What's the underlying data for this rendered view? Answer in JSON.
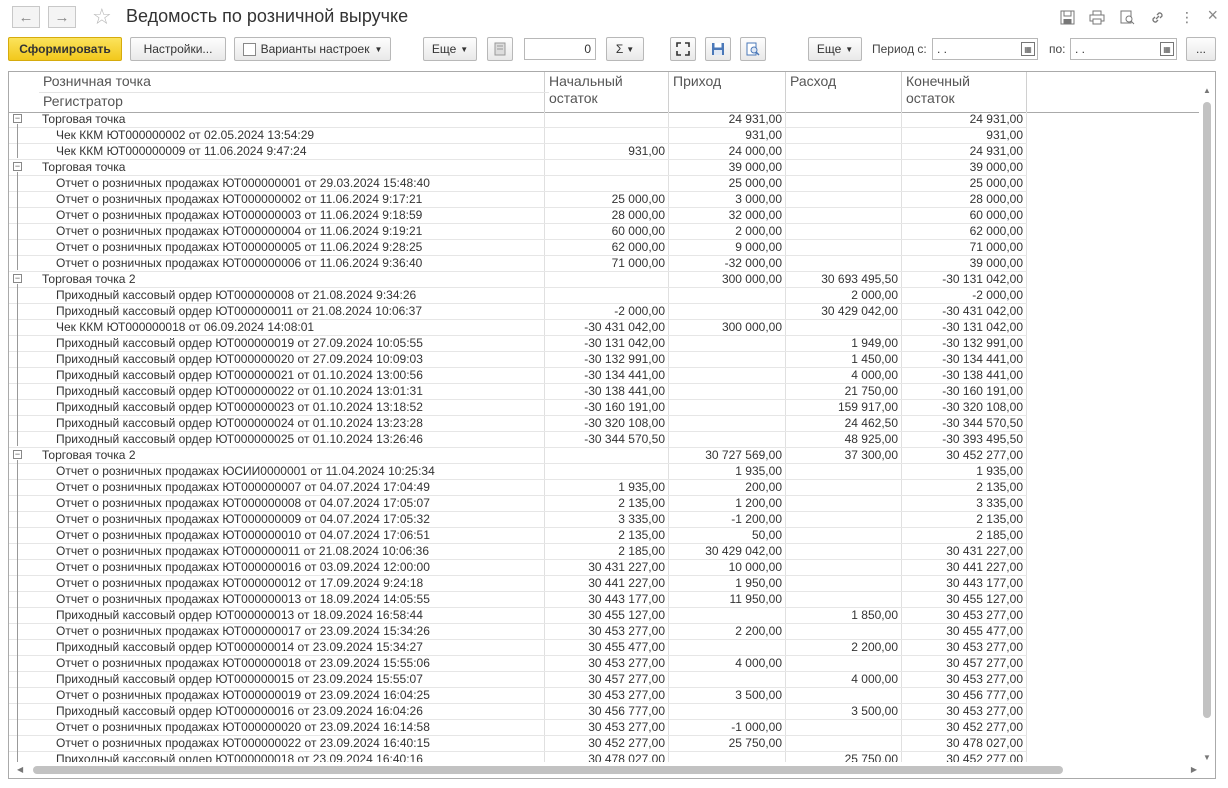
{
  "window": {
    "title": "Ведомость по розничной выручке"
  },
  "toolbar": {
    "generate": "Сформировать",
    "settings": "Настройки...",
    "variants": "Варианты настроек",
    "more1": "Еще",
    "counter_value": "0",
    "sum_symbol": "Σ",
    "more2": "Еще",
    "period_from_label": "Период с:",
    "period_from_value": ". .",
    "period_to_label": "по:",
    "period_to_value": ". .",
    "ellipsis": "..."
  },
  "table": {
    "headers": {
      "point": "Розничная точка",
      "registrar": "Регистратор",
      "opening_l1": "Начальный",
      "opening_l2": "остаток",
      "income": "Приход",
      "expense": "Расход",
      "closing_l1": "Конечный",
      "closing_l2": "остаток"
    },
    "rows": [
      {
        "g": 1,
        "name": "Торговая точка",
        "o": "",
        "i": "24 931,00",
        "e": "",
        "c": "24 931,00"
      },
      {
        "g": 0,
        "name": "Чек ККМ ЮТ000000002 от 02.05.2024 13:54:29",
        "o": "",
        "i": "931,00",
        "e": "",
        "c": "931,00"
      },
      {
        "g": 0,
        "name": "Чек ККМ ЮТ000000009 от 11.06.2024 9:47:24",
        "o": "931,00",
        "i": "24 000,00",
        "e": "",
        "c": "24 931,00"
      },
      {
        "g": 1,
        "name": "Торговая точка",
        "o": "",
        "i": "39 000,00",
        "e": "",
        "c": "39 000,00"
      },
      {
        "g": 0,
        "name": "Отчет о розничных продажах ЮТ000000001 от 29.03.2024 15:48:40",
        "o": "",
        "i": "25 000,00",
        "e": "",
        "c": "25 000,00"
      },
      {
        "g": 0,
        "name": "Отчет о розничных продажах ЮТ000000002 от 11.06.2024 9:17:21",
        "o": "25 000,00",
        "i": "3 000,00",
        "e": "",
        "c": "28 000,00"
      },
      {
        "g": 0,
        "name": "Отчет о розничных продажах ЮТ000000003 от 11.06.2024 9:18:59",
        "o": "28 000,00",
        "i": "32 000,00",
        "e": "",
        "c": "60 000,00"
      },
      {
        "g": 0,
        "name": "Отчет о розничных продажах ЮТ000000004 от 11.06.2024 9:19:21",
        "o": "60 000,00",
        "i": "2 000,00",
        "e": "",
        "c": "62 000,00"
      },
      {
        "g": 0,
        "name": "Отчет о розничных продажах ЮТ000000005 от 11.06.2024 9:28:25",
        "o": "62 000,00",
        "i": "9 000,00",
        "e": "",
        "c": "71 000,00"
      },
      {
        "g": 0,
        "name": "Отчет о розничных продажах ЮТ000000006 от 11.06.2024 9:36:40",
        "o": "71 000,00",
        "i": "-32 000,00",
        "e": "",
        "c": "39 000,00"
      },
      {
        "g": 1,
        "name": "Торговая точка 2",
        "o": "",
        "i": "300 000,00",
        "e": "30 693 495,50",
        "c": "-30 131 042,00"
      },
      {
        "g": 0,
        "name": "Приходный кассовый ордер ЮТ000000008 от 21.08.2024 9:34:26",
        "o": "",
        "i": "",
        "e": "2 000,00",
        "c": "-2 000,00"
      },
      {
        "g": 0,
        "name": "Приходный кассовый ордер ЮТ000000011 от 21.08.2024 10:06:37",
        "o": "-2 000,00",
        "i": "",
        "e": "30 429 042,00",
        "c": "-30 431 042,00"
      },
      {
        "g": 0,
        "name": "Чек ККМ ЮТ000000018 от 06.09.2024 14:08:01",
        "o": "-30 431 042,00",
        "i": "300 000,00",
        "e": "",
        "c": "-30 131 042,00"
      },
      {
        "g": 0,
        "name": "Приходный кассовый ордер ЮТ000000019 от 27.09.2024 10:05:55",
        "o": "-30 131 042,00",
        "i": "",
        "e": "1 949,00",
        "c": "-30 132 991,00"
      },
      {
        "g": 0,
        "name": "Приходный кассовый ордер ЮТ000000020 от 27.09.2024 10:09:03",
        "o": "-30 132 991,00",
        "i": "",
        "e": "1 450,00",
        "c": "-30 134 441,00"
      },
      {
        "g": 0,
        "name": "Приходный кассовый ордер ЮТ000000021 от 01.10.2024 13:00:56",
        "o": "-30 134 441,00",
        "i": "",
        "e": "4 000,00",
        "c": "-30 138 441,00"
      },
      {
        "g": 0,
        "name": "Приходный кассовый ордер ЮТ000000022 от 01.10.2024 13:01:31",
        "o": "-30 138 441,00",
        "i": "",
        "e": "21 750,00",
        "c": "-30 160 191,00"
      },
      {
        "g": 0,
        "name": "Приходный кассовый ордер ЮТ000000023 от 01.10.2024 13:18:52",
        "o": "-30 160 191,00",
        "i": "",
        "e": "159 917,00",
        "c": "-30 320 108,00"
      },
      {
        "g": 0,
        "name": "Приходный кассовый ордер ЮТ000000024 от 01.10.2024 13:23:28",
        "o": "-30 320 108,00",
        "i": "",
        "e": "24 462,50",
        "c": "-30 344 570,50"
      },
      {
        "g": 0,
        "name": "Приходный кассовый ордер ЮТ000000025 от 01.10.2024 13:26:46",
        "o": "-30 344 570,50",
        "i": "",
        "e": "48 925,00",
        "c": "-30 393 495,50"
      },
      {
        "g": 1,
        "name": "Торговая точка 2",
        "o": "",
        "i": "30 727 569,00",
        "e": "37 300,00",
        "c": "30 452 277,00"
      },
      {
        "g": 0,
        "name": "Отчет о розничных продажах ЮСИИ0000001 от 11.04.2024 10:25:34",
        "o": "",
        "i": "1 935,00",
        "e": "",
        "c": "1 935,00"
      },
      {
        "g": 0,
        "name": "Отчет о розничных продажах ЮТ000000007 от 04.07.2024 17:04:49",
        "o": "1 935,00",
        "i": "200,00",
        "e": "",
        "c": "2 135,00"
      },
      {
        "g": 0,
        "name": "Отчет о розничных продажах ЮТ000000008 от 04.07.2024 17:05:07",
        "o": "2 135,00",
        "i": "1 200,00",
        "e": "",
        "c": "3 335,00"
      },
      {
        "g": 0,
        "name": "Отчет о розничных продажах ЮТ000000009 от 04.07.2024 17:05:32",
        "o": "3 335,00",
        "i": "-1 200,00",
        "e": "",
        "c": "2 135,00"
      },
      {
        "g": 0,
        "name": "Отчет о розничных продажах ЮТ000000010 от 04.07.2024 17:06:51",
        "o": "2 135,00",
        "i": "50,00",
        "e": "",
        "c": "2 185,00"
      },
      {
        "g": 0,
        "name": "Отчет о розничных продажах ЮТ000000011 от 21.08.2024 10:06:36",
        "o": "2 185,00",
        "i": "30 429 042,00",
        "e": "",
        "c": "30 431 227,00"
      },
      {
        "g": 0,
        "name": "Отчет о розничных продажах ЮТ000000016 от 03.09.2024 12:00:00",
        "o": "30 431 227,00",
        "i": "10 000,00",
        "e": "",
        "c": "30 441 227,00"
      },
      {
        "g": 0,
        "name": "Отчет о розничных продажах ЮТ000000012 от 17.09.2024 9:24:18",
        "o": "30 441 227,00",
        "i": "1 950,00",
        "e": "",
        "c": "30 443 177,00"
      },
      {
        "g": 0,
        "name": "Отчет о розничных продажах ЮТ000000013 от 18.09.2024 14:05:55",
        "o": "30 443 177,00",
        "i": "11 950,00",
        "e": "",
        "c": "30 455 127,00"
      },
      {
        "g": 0,
        "name": "Приходный кассовый ордер ЮТ000000013 от 18.09.2024 16:58:44",
        "o": "30 455 127,00",
        "i": "",
        "e": "1 850,00",
        "c": "30 453 277,00"
      },
      {
        "g": 0,
        "name": "Отчет о розничных продажах ЮТ000000017 от 23.09.2024 15:34:26",
        "o": "30 453 277,00",
        "i": "2 200,00",
        "e": "",
        "c": "30 455 477,00"
      },
      {
        "g": 0,
        "name": "Приходный кассовый ордер ЮТ000000014 от 23.09.2024 15:34:27",
        "o": "30 455 477,00",
        "i": "",
        "e": "2 200,00",
        "c": "30 453 277,00"
      },
      {
        "g": 0,
        "name": "Отчет о розничных продажах ЮТ000000018 от 23.09.2024 15:55:06",
        "o": "30 453 277,00",
        "i": "4 000,00",
        "e": "",
        "c": "30 457 277,00"
      },
      {
        "g": 0,
        "name": "Приходный кассовый ордер ЮТ000000015 от 23.09.2024 15:55:07",
        "o": "30 457 277,00",
        "i": "",
        "e": "4 000,00",
        "c": "30 453 277,00"
      },
      {
        "g": 0,
        "name": "Отчет о розничных продажах ЮТ000000019 от 23.09.2024 16:04:25",
        "o": "30 453 277,00",
        "i": "3 500,00",
        "e": "",
        "c": "30 456 777,00"
      },
      {
        "g": 0,
        "name": "Приходный кассовый ордер ЮТ000000016 от 23.09.2024 16:04:26",
        "o": "30 456 777,00",
        "i": "",
        "e": "3 500,00",
        "c": "30 453 277,00"
      },
      {
        "g": 0,
        "name": "Отчет о розничных продажах ЮТ000000020 от 23.09.2024 16:14:58",
        "o": "30 453 277,00",
        "i": "-1 000,00",
        "e": "",
        "c": "30 452 277,00"
      },
      {
        "g": 0,
        "name": "Отчет о розничных продажах ЮТ000000022 от 23.09.2024 16:40:15",
        "o": "30 452 277,00",
        "i": "25 750,00",
        "e": "",
        "c": "30 478 027,00"
      },
      {
        "g": 0,
        "name": "Приходный кассовый ордер ЮТ000000018 от 23.09.2024 16:40:16",
        "o": "30 478 027,00",
        "i": "",
        "e": "25 750,00",
        "c": "30 452 277,00"
      }
    ]
  },
  "colors": {
    "accent": "#f2c81c",
    "border": "#aaaaaa"
  }
}
